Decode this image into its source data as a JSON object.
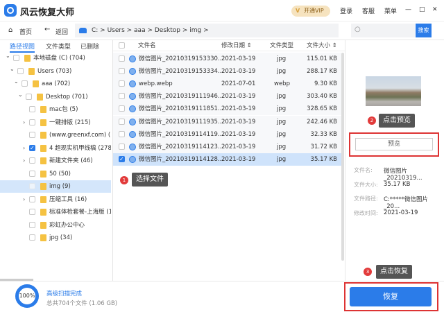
{
  "app": {
    "title": "风云恢复大师",
    "vip": "开通VIP",
    "login": "登录",
    "service": "客服",
    "menu": "菜单",
    "minimize": "—",
    "maximize": "□",
    "close": "✕"
  },
  "toolbar": {
    "home": "首页",
    "back": "返回",
    "path": "C: > Users > aaa > Desktop > img >",
    "search_placeholder": "",
    "search_button": "搜索"
  },
  "left_tabs": [
    "路径视图",
    "文件类型",
    "已删除"
  ],
  "tree": [
    {
      "label": "本地磁盘 (C) (704)",
      "level": 0,
      "arrow": "expanded",
      "checked": false
    },
    {
      "label": "Users (703)",
      "level": 1,
      "arrow": "expanded",
      "checked": false
    },
    {
      "label": "aaa (702)",
      "level": 2,
      "arrow": "expanded",
      "checked": false
    },
    {
      "label": "Desktop (701)",
      "level": 3,
      "arrow": "expanded",
      "checked": false
    },
    {
      "label": "mac包 (5)",
      "level": 4,
      "arrow": "",
      "checked": false
    },
    {
      "label": "一键排版 (215)",
      "level": 4,
      "arrow": "collapsed",
      "checked": false
    },
    {
      "label": "(www.greenxf.com) (1) (",
      "level": 4,
      "arrow": "",
      "checked": false
    },
    {
      "label": "4 超现实机甲线稿 (278)",
      "level": 4,
      "arrow": "collapsed",
      "checked": true
    },
    {
      "label": "新建文件夹 (46)",
      "level": 4,
      "arrow": "collapsed",
      "checked": false
    },
    {
      "label": "50 (50)",
      "level": 4,
      "arrow": "",
      "checked": false
    },
    {
      "label": "img (9)",
      "level": 4,
      "arrow": "",
      "checked": false,
      "selected": true
    },
    {
      "label": "压缩工具 (16)",
      "level": 4,
      "arrow": "collapsed",
      "checked": false
    },
    {
      "label": "标准体检套餐-上海版 (1)",
      "level": 4,
      "arrow": "",
      "checked": false
    },
    {
      "label": "彩虹办公中心",
      "level": 4,
      "arrow": "",
      "checked": false
    },
    {
      "label": "jpg (34)",
      "level": 4,
      "arrow": "",
      "checked": false
    }
  ],
  "list": {
    "headers": {
      "name": "文件名",
      "date": "修改日期 ⇕",
      "type": "文件类型",
      "size": "文件大小 ⇕"
    },
    "rows": [
      {
        "name": "微信图片_20210319153330...",
        "date": "2021-03-19",
        "type": "jpg",
        "size": "115.01  KB",
        "checked": false
      },
      {
        "name": "微信图片_20210319153334...",
        "date": "2021-03-19",
        "type": "jpg",
        "size": "288.17  KB",
        "checked": false
      },
      {
        "name": "webp.webp",
        "date": "2021-07-01",
        "type": "webp",
        "size": "9.30  KB",
        "checked": false
      },
      {
        "name": "微信图片_20210319111946...",
        "date": "2021-03-19",
        "type": "jpg",
        "size": "303.40  KB",
        "checked": false
      },
      {
        "name": "微信图片_20210319111851...",
        "date": "2021-03-19",
        "type": "jpg",
        "size": "328.65  KB",
        "checked": false
      },
      {
        "name": "微信图片_20210319111935...",
        "date": "2021-03-19",
        "type": "jpg",
        "size": "242.46  KB",
        "checked": false
      },
      {
        "name": "微信图片_20210319114119...",
        "date": "2021-03-19",
        "type": "jpg",
        "size": "32.33  KB",
        "checked": false
      },
      {
        "name": "微信图片_20210319114123...",
        "date": "2021-03-19",
        "type": "jpg",
        "size": "31.72  KB",
        "checked": false
      },
      {
        "name": "微信图片_20210319114128...",
        "date": "2021-03-19",
        "type": "jpg",
        "size": "35.17  KB",
        "checked": true,
        "selected": true
      }
    ]
  },
  "tips": {
    "step1_num": "1",
    "step1": "选择文件",
    "step2_num": "2",
    "step2": "点击预览",
    "step3_num": "3",
    "step3": "点击恢复"
  },
  "preview": {
    "button": "预览",
    "info": [
      {
        "key": "文件名:",
        "value": "微信图片_20210319..."
      },
      {
        "key": "文件大小:",
        "value": "35.17 KB"
      },
      {
        "key": "文件路径:",
        "value": "C:*****微信图片_20..."
      },
      {
        "key": "修改时间:",
        "value": "2021-03-19"
      }
    ]
  },
  "footer": {
    "progress": "100%",
    "status": "高级扫描完成",
    "summary": "总共704个文件 (1.06 GB)",
    "recover": "恢复"
  },
  "colors": {
    "accent": "#2b7ce9",
    "highlight": "#d33333",
    "tip_bg": "#555555"
  }
}
